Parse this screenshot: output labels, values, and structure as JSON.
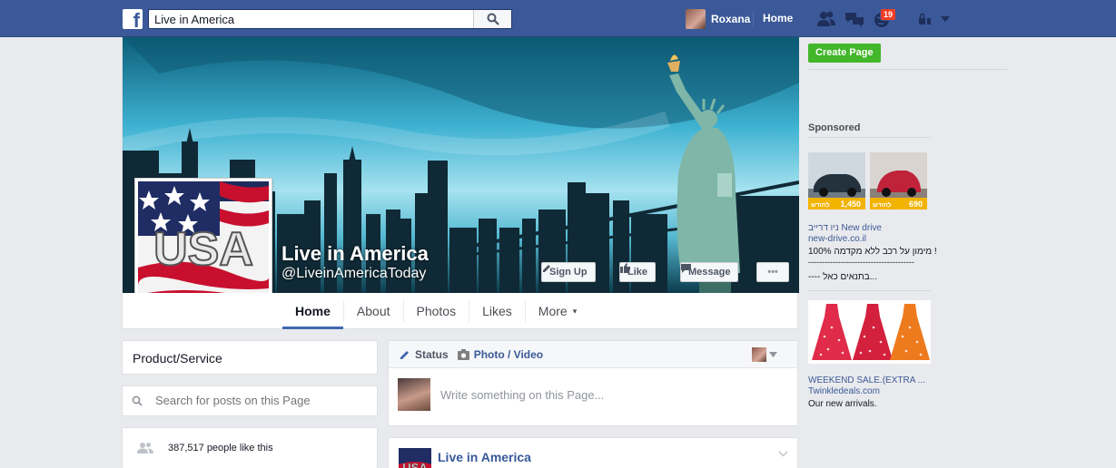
{
  "topbar": {
    "logo": "f",
    "search_value": "Live in America",
    "user_name": "Roxana",
    "home_label": "Home",
    "notification_count": "19",
    "icons": [
      "friend-requests-icon",
      "messages-icon",
      "notifications-globe-icon",
      "privacy-lock-icon",
      "account-menu-arrow-icon"
    ]
  },
  "page": {
    "name": "Live in America",
    "handle": "@LiveinAmericaToday",
    "profile_text": "USA",
    "buttons": {
      "signup": "Sign Up",
      "like": "Like",
      "message": "Message",
      "more": "•••"
    },
    "tabs": [
      "Home",
      "About",
      "Photos",
      "Likes",
      "More"
    ],
    "more_caret": "▾"
  },
  "left": {
    "category": "Product/Service",
    "search_placeholder": "Search for posts on this Page",
    "likes_text": "387,517 people like this"
  },
  "composer": {
    "status_label": "Status",
    "photo_label": "Photo / Video",
    "placeholder": "Write something on this Page..."
  },
  "post": {
    "author": "Live in America",
    "av_text": "USA"
  },
  "right": {
    "create_page": "Create Page",
    "sponsored": "Sponsored",
    "ad1": {
      "price1": "1,450",
      "price2": "690",
      "per_month": "לחודש",
      "title": "ניו דרייב New drive",
      "url": "new-drive.co.il",
      "desc": "100% מימון על רכב ללא מקדמה !",
      "dashes": "---------------------------------------",
      "extra": "---- בתנאים כאל..."
    },
    "ad2": {
      "title": "WEEKEND SALE.(EXTRA ...",
      "url": "Twinkledeals.com",
      "desc": "Our new arrivals."
    }
  },
  "colors": {
    "brand": "#3b5998",
    "link": "#365899",
    "green": "#42b72a",
    "badge": "#f03d25"
  }
}
